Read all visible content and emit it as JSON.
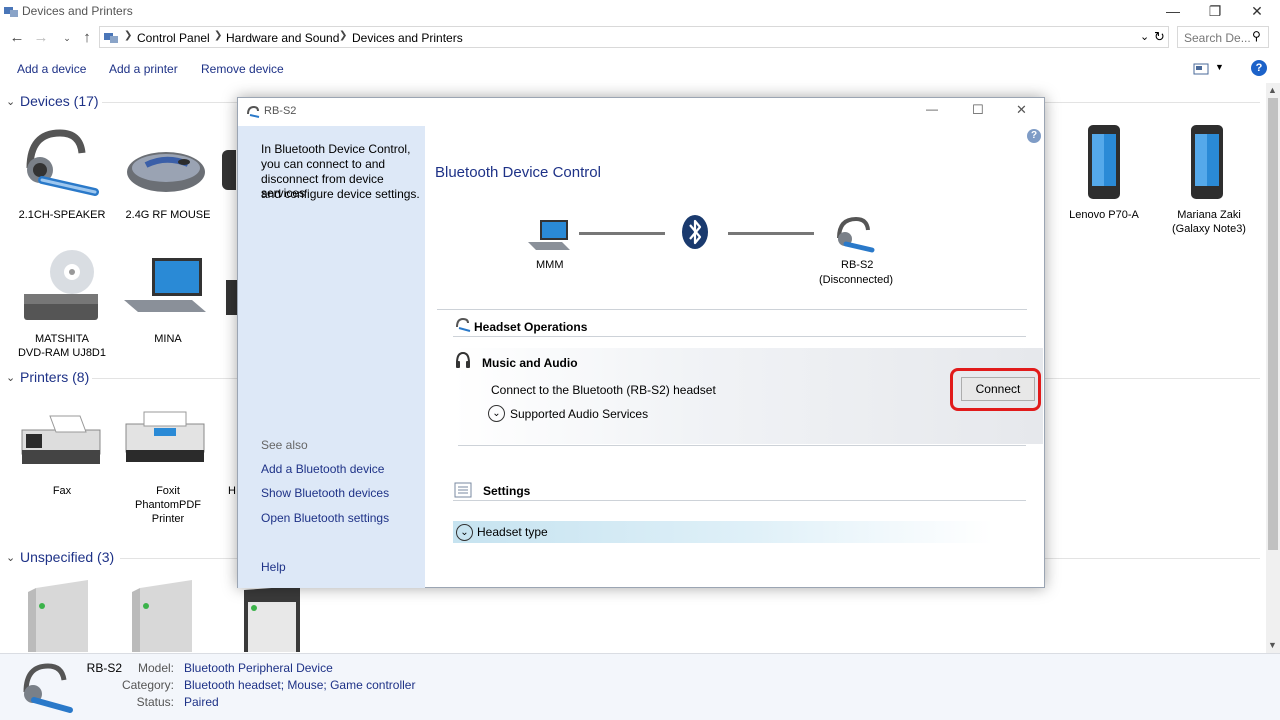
{
  "window": {
    "title": "Devices and Printers",
    "controls": {
      "minimize": "—",
      "restore": "❐",
      "close": "✕"
    }
  },
  "address": {
    "breadcrumbs": [
      "Control Panel",
      "Hardware and Sound",
      "Devices and Printers"
    ],
    "search_placeholder": "Search De..."
  },
  "commands": [
    "Add a device",
    "Add a printer",
    "Remove device"
  ],
  "groups": {
    "devices": "Devices (17)",
    "printers": "Printers (8)",
    "unspecified": "Unspecified (3)"
  },
  "devices": {
    "speaker": "2.1CH-SPEAKER",
    "mouse": "2.4G RF MOUSE",
    "phone1": "Lenovo P70-A",
    "phone2_line1": "Mariana Zaki",
    "phone2_line2": "(Galaxy Note3)",
    "dvd_line1": "MATSHITA",
    "dvd_line2": "DVD-RAM UJ8D1",
    "laptop": "MINA"
  },
  "printers": {
    "fax": "Fax",
    "foxit_line1": "Foxit",
    "foxit_line2": "PhantomPDF",
    "foxit_line3": "Printer",
    "partial": "H"
  },
  "details": {
    "name": "RB-S2",
    "model_label": "Model:",
    "model": "Bluetooth Peripheral Device",
    "category_label": "Category:",
    "category": "Bluetooth headset; Mouse; Game controller",
    "status_label": "Status:",
    "status": "Paired"
  },
  "dialog": {
    "title": "RB-S2",
    "side_text": [
      "In Bluetooth Device Control,",
      "you can connect to and",
      "disconnect from device services",
      "and configure device settings."
    ],
    "see_also": "See also",
    "links": [
      "Add a Bluetooth device",
      "Show Bluetooth devices",
      "Open Bluetooth settings"
    ],
    "help": "Help",
    "heading": "Bluetooth Device Control",
    "computer_name": "MMM",
    "device_name": "RB-S2",
    "device_status": "(Disconnected)",
    "headset_ops": "Headset Operations",
    "music_audio": "Music and Audio",
    "connect_desc": "Connect to the Bluetooth (RB-S2) headset",
    "supported": "Supported Audio Services",
    "connect_btn": "Connect",
    "settings": "Settings",
    "headset_type": "Headset type"
  },
  "colors": {
    "link": "#1e3287",
    "highlight": "#e11b1b",
    "sidebar": "#dde8f7",
    "bluetooth": "#1a3a6e"
  }
}
